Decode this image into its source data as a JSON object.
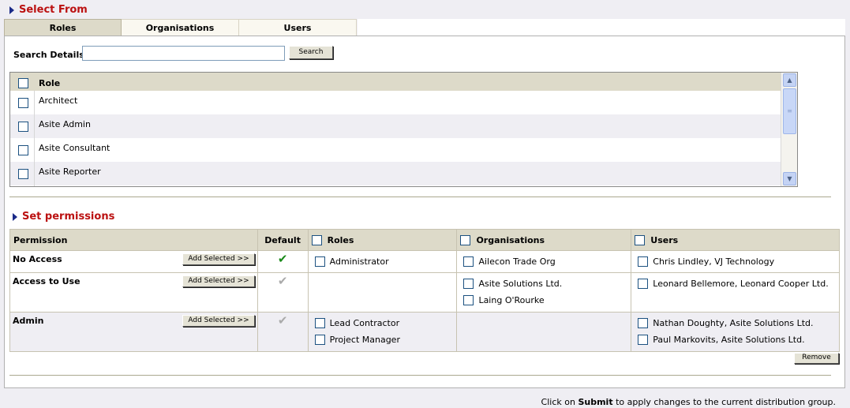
{
  "select_from": {
    "title": "Select From",
    "tabs": [
      "Roles",
      "Organisations",
      "Users"
    ],
    "active_tab": "Roles",
    "search_label": "Search Details:",
    "search_value": "",
    "search_button": "Search",
    "role_header": "Role",
    "roles": [
      "Architect",
      "Asite Admin",
      "Asite Consultant",
      "Asite Reporter"
    ]
  },
  "set_permissions": {
    "title": "Set permissions",
    "headers": {
      "permission": "Permission",
      "default": "Default",
      "roles": "Roles",
      "organisations": "Organisations",
      "users": "Users"
    },
    "add_button": "Add Selected >>",
    "rows": [
      {
        "permission": "No Access",
        "default_checked": true,
        "roles": [
          "Administrator"
        ],
        "organisations": [
          "Ailecon Trade Org"
        ],
        "users": [
          "Chris Lindley, VJ Technology"
        ]
      },
      {
        "permission": "Access to Use",
        "default_checked": false,
        "roles": [],
        "organisations": [
          "Asite Solutions Ltd.",
          "Laing O'Rourke"
        ],
        "users": [
          "Leonard Bellemore, Leonard Cooper Ltd."
        ]
      },
      {
        "permission": "Admin",
        "default_checked": false,
        "roles": [
          "Lead Contractor",
          "Project Manager"
        ],
        "organisations": [],
        "users": [
          "Nathan Doughty, Asite Solutions Ltd.",
          "Paul Markovits, Asite Solutions Ltd."
        ]
      }
    ],
    "remove_button": "Remove"
  },
  "footer": {
    "prefix": "Click on",
    "keyword": "Submit",
    "suffix": "to apply changes to the current distribution group."
  },
  "icons": {
    "check_on_color": "#1a8a1a",
    "check_off_color": "#aaaaaa",
    "section_title_color": "#bb1111",
    "triangle_color": "#1a2a88"
  }
}
